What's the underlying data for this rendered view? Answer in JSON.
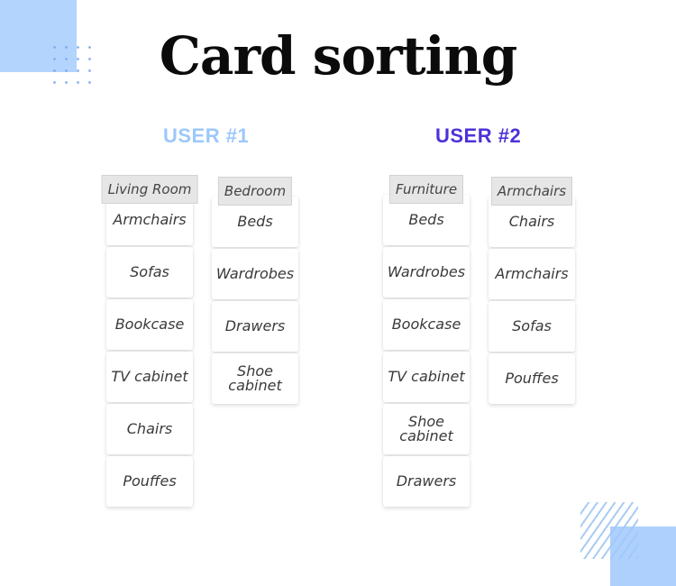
{
  "title": "Card sorting",
  "colors": {
    "user1": "#9cc8fb",
    "user2": "#4e31d8",
    "decoration": "#b3d4fd",
    "category_header_bg": "#e6e6e6",
    "card_bg": "#ffffff"
  },
  "users": [
    {
      "label": "USER #1",
      "groups": [
        {
          "category": "Living Room",
          "cards": [
            "Armchairs",
            "Sofas",
            "Bookcase",
            "TV cabinet",
            "Chairs",
            "Pouffes"
          ]
        },
        {
          "category": "Bedroom",
          "cards": [
            "Beds",
            "Wardrobes",
            "Drawers",
            "Shoe cabinet"
          ]
        }
      ]
    },
    {
      "label": "USER #2",
      "groups": [
        {
          "category": "Furniture",
          "cards": [
            "Beds",
            "Wardrobes",
            "Bookcase",
            "TV cabinet",
            "Shoe cabinet",
            "Drawers"
          ]
        },
        {
          "category": "Armchairs",
          "cards": [
            "Chairs",
            "Armchairs",
            "Sofas",
            "Pouffes"
          ]
        }
      ]
    }
  ]
}
